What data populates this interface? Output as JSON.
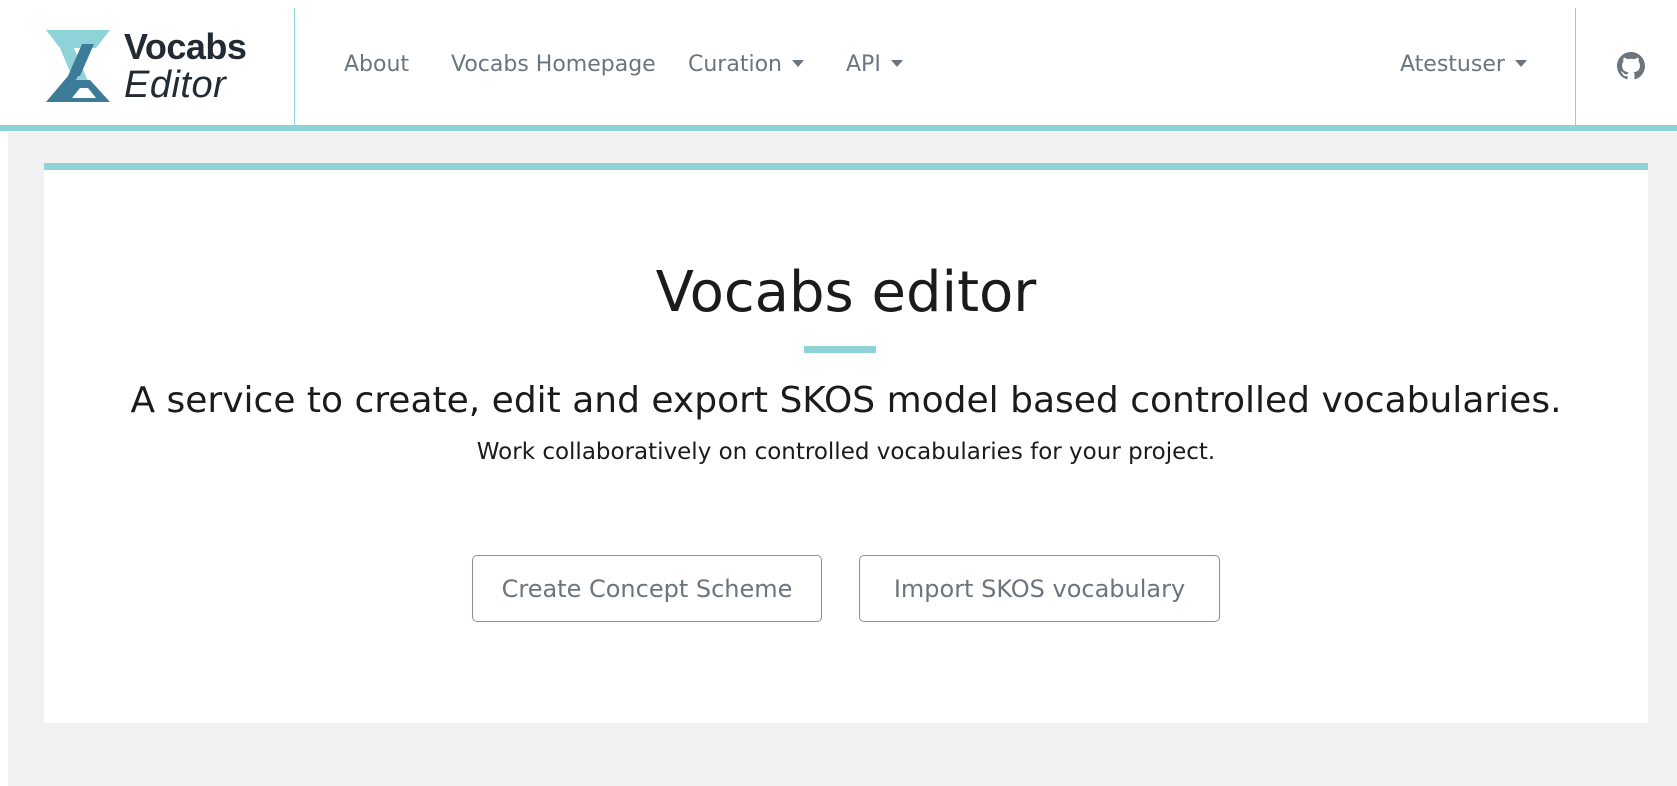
{
  "brand": {
    "line1": "Vocabs",
    "line2": "Editor",
    "colors": {
      "light": "#8fd3d8",
      "dark": "#3d7c98"
    }
  },
  "nav": {
    "about": "About",
    "homepage": "Vocabs Homepage",
    "curation": "Curation",
    "api": "API",
    "user": "Atestuser",
    "github_icon": "github-icon"
  },
  "hero": {
    "title": "Vocabs editor",
    "subtitle": "A service to create, edit and export SKOS model based controlled vocabularies.",
    "tagline": "Work collaboratively on controlled vocabularies for your project."
  },
  "actions": {
    "create": "Create Concept Scheme",
    "import": "Import SKOS vocabulary"
  },
  "theme": {
    "accent": "#8fd3d8",
    "page_bg": "#f1f1f1",
    "nav_text": "#6c757d"
  }
}
